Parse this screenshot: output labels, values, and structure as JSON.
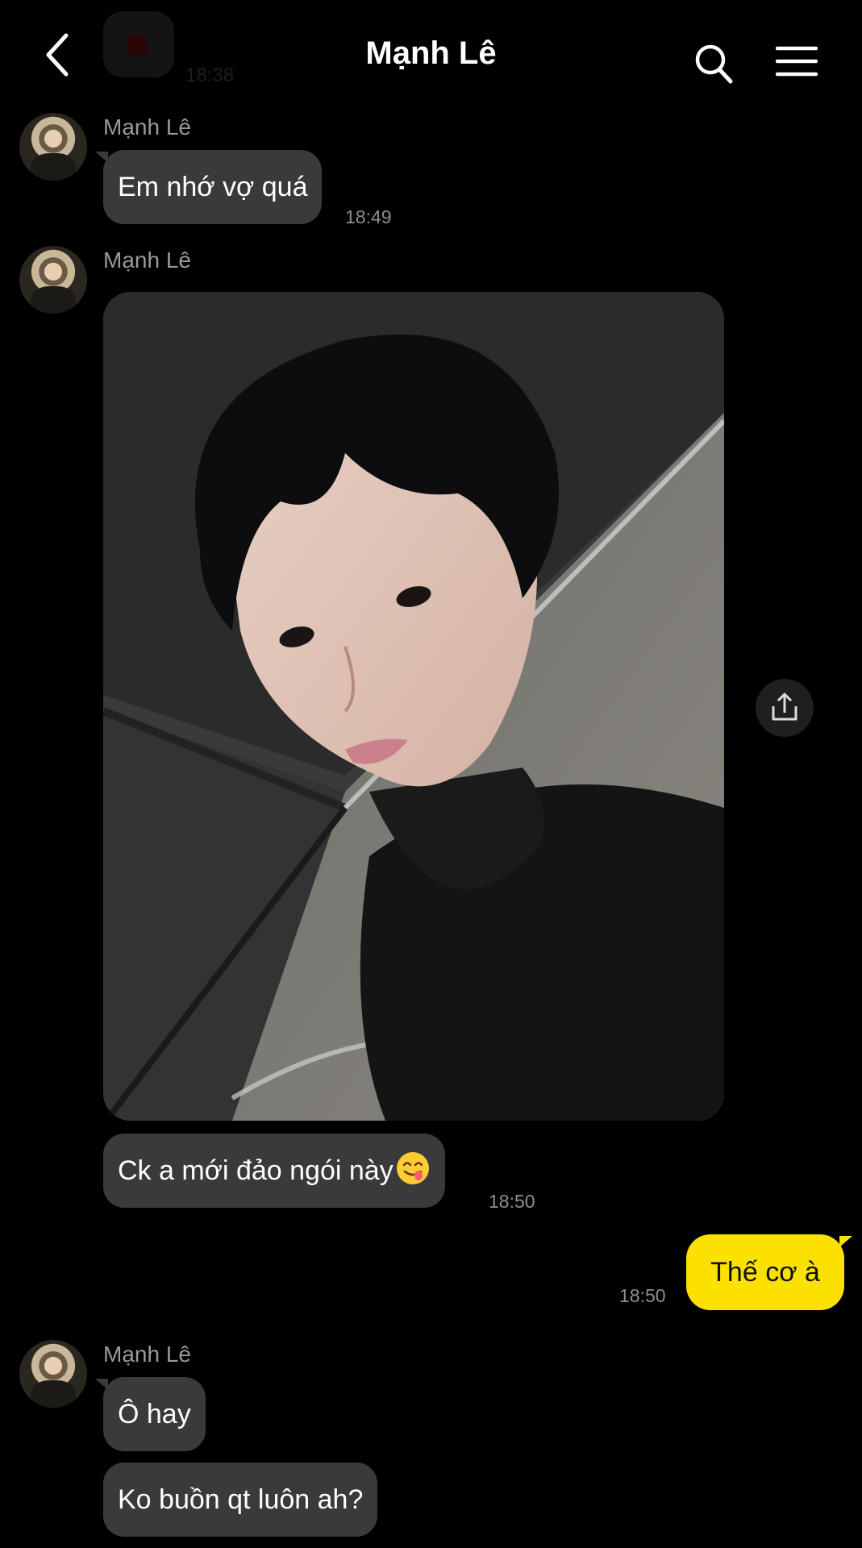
{
  "header": {
    "title": "Mạnh Lê",
    "ghost_time": "18:38",
    "icons": {
      "back": "chevron-left-icon",
      "search": "search-icon",
      "menu": "hamburger-menu-icon"
    }
  },
  "messages": [
    {
      "sender": "Mạnh Lê",
      "text": "Em nhớ vợ quá",
      "time": "18:49"
    },
    {
      "sender": "Mạnh Lê",
      "type": "photo",
      "text": "Ck a mới đảo ngói này",
      "emoji": "yum-face-emoji",
      "time": "18:50"
    },
    {
      "sender": "me",
      "text": "Thế cơ à",
      "time": "18:50"
    },
    {
      "sender": "Mạnh Lê",
      "text": "Ô hay"
    },
    {
      "text": "Ko buồn qt luôn ah?"
    }
  ],
  "colors": {
    "background": "#000000",
    "incoming_bubble": "#3a3a3c",
    "outgoing_bubble": "#fae100",
    "muted_text": "#9a9a9a"
  },
  "share_icon": "share-icon"
}
